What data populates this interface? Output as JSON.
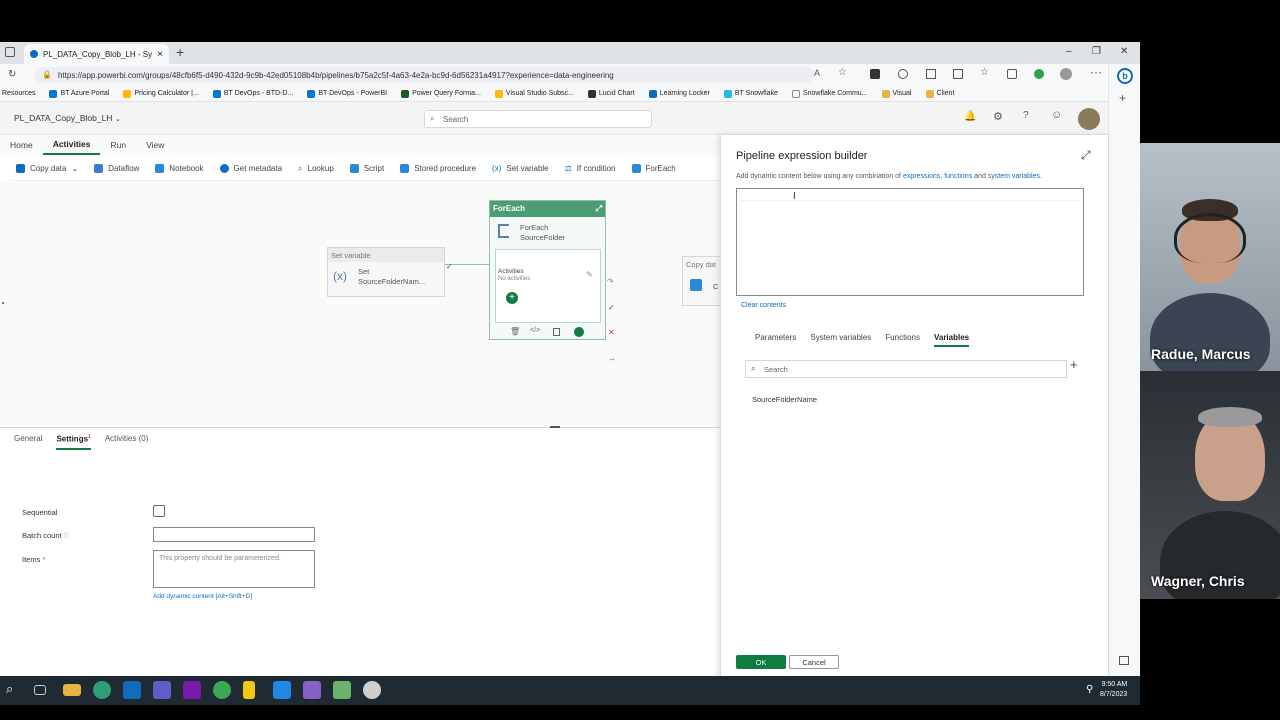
{
  "browser": {
    "tab_title": "PL_DATA_Copy_Blob_LH - Synaps",
    "tab_close": "×",
    "new_tab": "+",
    "url": "https://app.powerbi.com/groups/48cfb6f5-d490-432d-9c9b-42ed05108b4b/pipelines/b75a2c5f-4a63-4e2a-bc9d-6d56231a4917?experience=data-engineering",
    "window_controls": [
      "–",
      "❐",
      "✕"
    ],
    "favorites": [
      {
        "label": "Resources",
        "color": "#666666"
      },
      {
        "label": "BT Azure Portal",
        "color": "#0078d4"
      },
      {
        "label": "Pricing Calculator |...",
        "color": "#ffb900"
      },
      {
        "label": "BT DevOps - BTD-D...",
        "color": "#0078d4"
      },
      {
        "label": "BT DevOps - PowerBI",
        "color": "#0078d4"
      },
      {
        "label": "Power Query Forma...",
        "color": "#1b5e20"
      },
      {
        "label": "Visual Studio Subsc...",
        "color": "#ffb900"
      },
      {
        "label": "Lucid Chart",
        "color": "#333333"
      },
      {
        "label": "Learning Locker",
        "color": "#0f6cbd"
      },
      {
        "label": "BT Snowflake",
        "color": "#29b5e8"
      },
      {
        "label": "Snowflake Commu...",
        "color": "#888888"
      },
      {
        "label": "Visual",
        "color": "#e8b340"
      },
      {
        "label": "Client",
        "color": "#e8b340"
      }
    ]
  },
  "app": {
    "name": "PL_DATA_Copy_Blob_LH",
    "search_placeholder": "Search",
    "menu_tabs": [
      "Home",
      "Activities",
      "Run",
      "View"
    ],
    "active_menu": "Activities",
    "toolbar": [
      {
        "label": "Copy data",
        "color": "#0f6cbd"
      },
      {
        "label": "Dataflow",
        "color": "#0f6cbd"
      },
      {
        "label": "Notebook",
        "color": "#0f6cbd"
      },
      {
        "label": "Get metadata",
        "color": "#0f6cbd"
      },
      {
        "label": "Lookup",
        "color": "#0f6cbd"
      },
      {
        "label": "Script",
        "color": "#0f6cbd"
      },
      {
        "label": "Stored procedure",
        "color": "#0f6cbd"
      },
      {
        "label": "Set variable",
        "color": "#0f6cbd"
      },
      {
        "label": "If condition",
        "color": "#0f6cbd"
      },
      {
        "label": "ForEach",
        "color": "#0f6cbd"
      }
    ]
  },
  "canvas": {
    "set_variable": {
      "header": "Set variable",
      "symbol": "(x)",
      "name_line1": "Set",
      "name_line2": "SourceFolderNam..."
    },
    "foreach": {
      "header": "ForEach",
      "name_line1": "ForEach",
      "name_line2": "SourceFolder",
      "activities_label": "Activities",
      "no_activities": "No activities"
    },
    "copy_data": {
      "header": "Copy dat",
      "label": "C"
    }
  },
  "bottom_panel": {
    "tabs": [
      "General",
      "Settings",
      "Activities (0)"
    ],
    "active_tab": "Settings",
    "settings_superscript": "1",
    "sequential_label": "Sequential",
    "batch_count_label": "Batch count",
    "items_label": "Items",
    "items_required": "*",
    "items_placeholder": "This property should be parameterized.",
    "add_dynamic": "Add dynamic content [Alt+Shift+D]"
  },
  "expression_builder": {
    "title": "Pipeline expression builder",
    "desc_prefix": "Add dynamic content below using any combination of ",
    "desc_link1": "expressions",
    "desc_sep1": ", ",
    "desc_link2": "functions",
    "desc_sep2": " and ",
    "desc_link3": "system variables",
    "desc_suffix": ".",
    "clear": "Clear contents",
    "tabs": [
      "Parameters",
      "System variables",
      "Functions",
      "Variables"
    ],
    "active_tab": "Variables",
    "search_placeholder": "Search",
    "variables": [
      "SourceFolderName"
    ],
    "ok": "OK",
    "cancel": "Cancel",
    "add": "+"
  },
  "taskbar": {
    "time": "9:50 AM",
    "date": "8/7/2023"
  },
  "participants": [
    {
      "name": "Radue, Marcus"
    },
    {
      "name": "Wagner, Chris"
    }
  ],
  "colors": {
    "accent": "#107c41",
    "link": "#0f6cbd",
    "foreach_header": "#4b9e74"
  }
}
